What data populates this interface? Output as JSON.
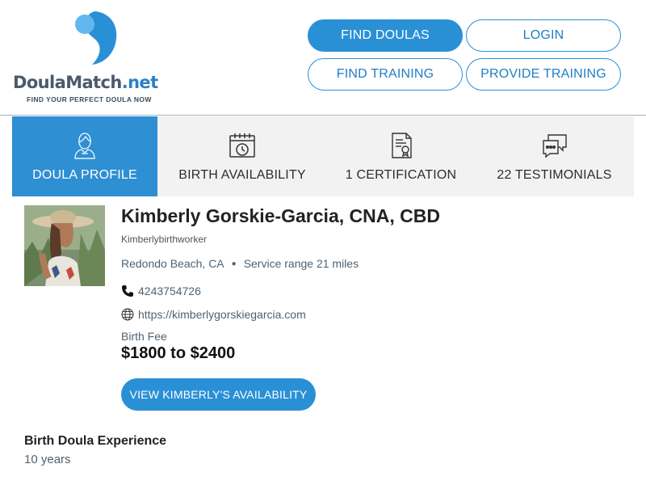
{
  "brand": {
    "name_part1": "Doula",
    "name_part2": "Match",
    "name_part3": ".net",
    "tagline": "FIND YOUR PERFECT DOULA NOW",
    "colors": {
      "blue": "#2a90d6",
      "light_blue": "#63b7ee",
      "gray": "#4a5a6a"
    }
  },
  "nav": {
    "find_doulas": "FIND DOULAS",
    "login": "LOGIN",
    "find_training": "FIND TRAINING",
    "provide_training": "PROVIDE TRAINING"
  },
  "tabs": [
    {
      "label": "DOULA PROFILE",
      "icon": "doula-person-icon",
      "active": true
    },
    {
      "label": "BIRTH AVAILABILITY",
      "icon": "calendar-clock-icon",
      "active": false
    },
    {
      "label": "1 CERTIFICATION",
      "icon": "certificate-document-icon",
      "active": false
    },
    {
      "label": "22 TESTIMONIALS",
      "icon": "chat-bubbles-icon",
      "active": false
    }
  ],
  "profile": {
    "name": "Kimberly Gorskie-Garcia, CNA, CBD",
    "username": "Kimberlybirthworker",
    "location": "Redondo Beach, CA",
    "service_range": "Service range 21 miles",
    "phone": "4243754726",
    "website": "https://kimberlygorskiegarcia.com",
    "fee_label": "Birth Fee",
    "fee_value": "$1800 to $2400",
    "availability_button": "VIEW KIMBERLY'S AVAILABILITY"
  },
  "experience": {
    "heading": "Birth Doula Experience",
    "value": "10 years"
  }
}
